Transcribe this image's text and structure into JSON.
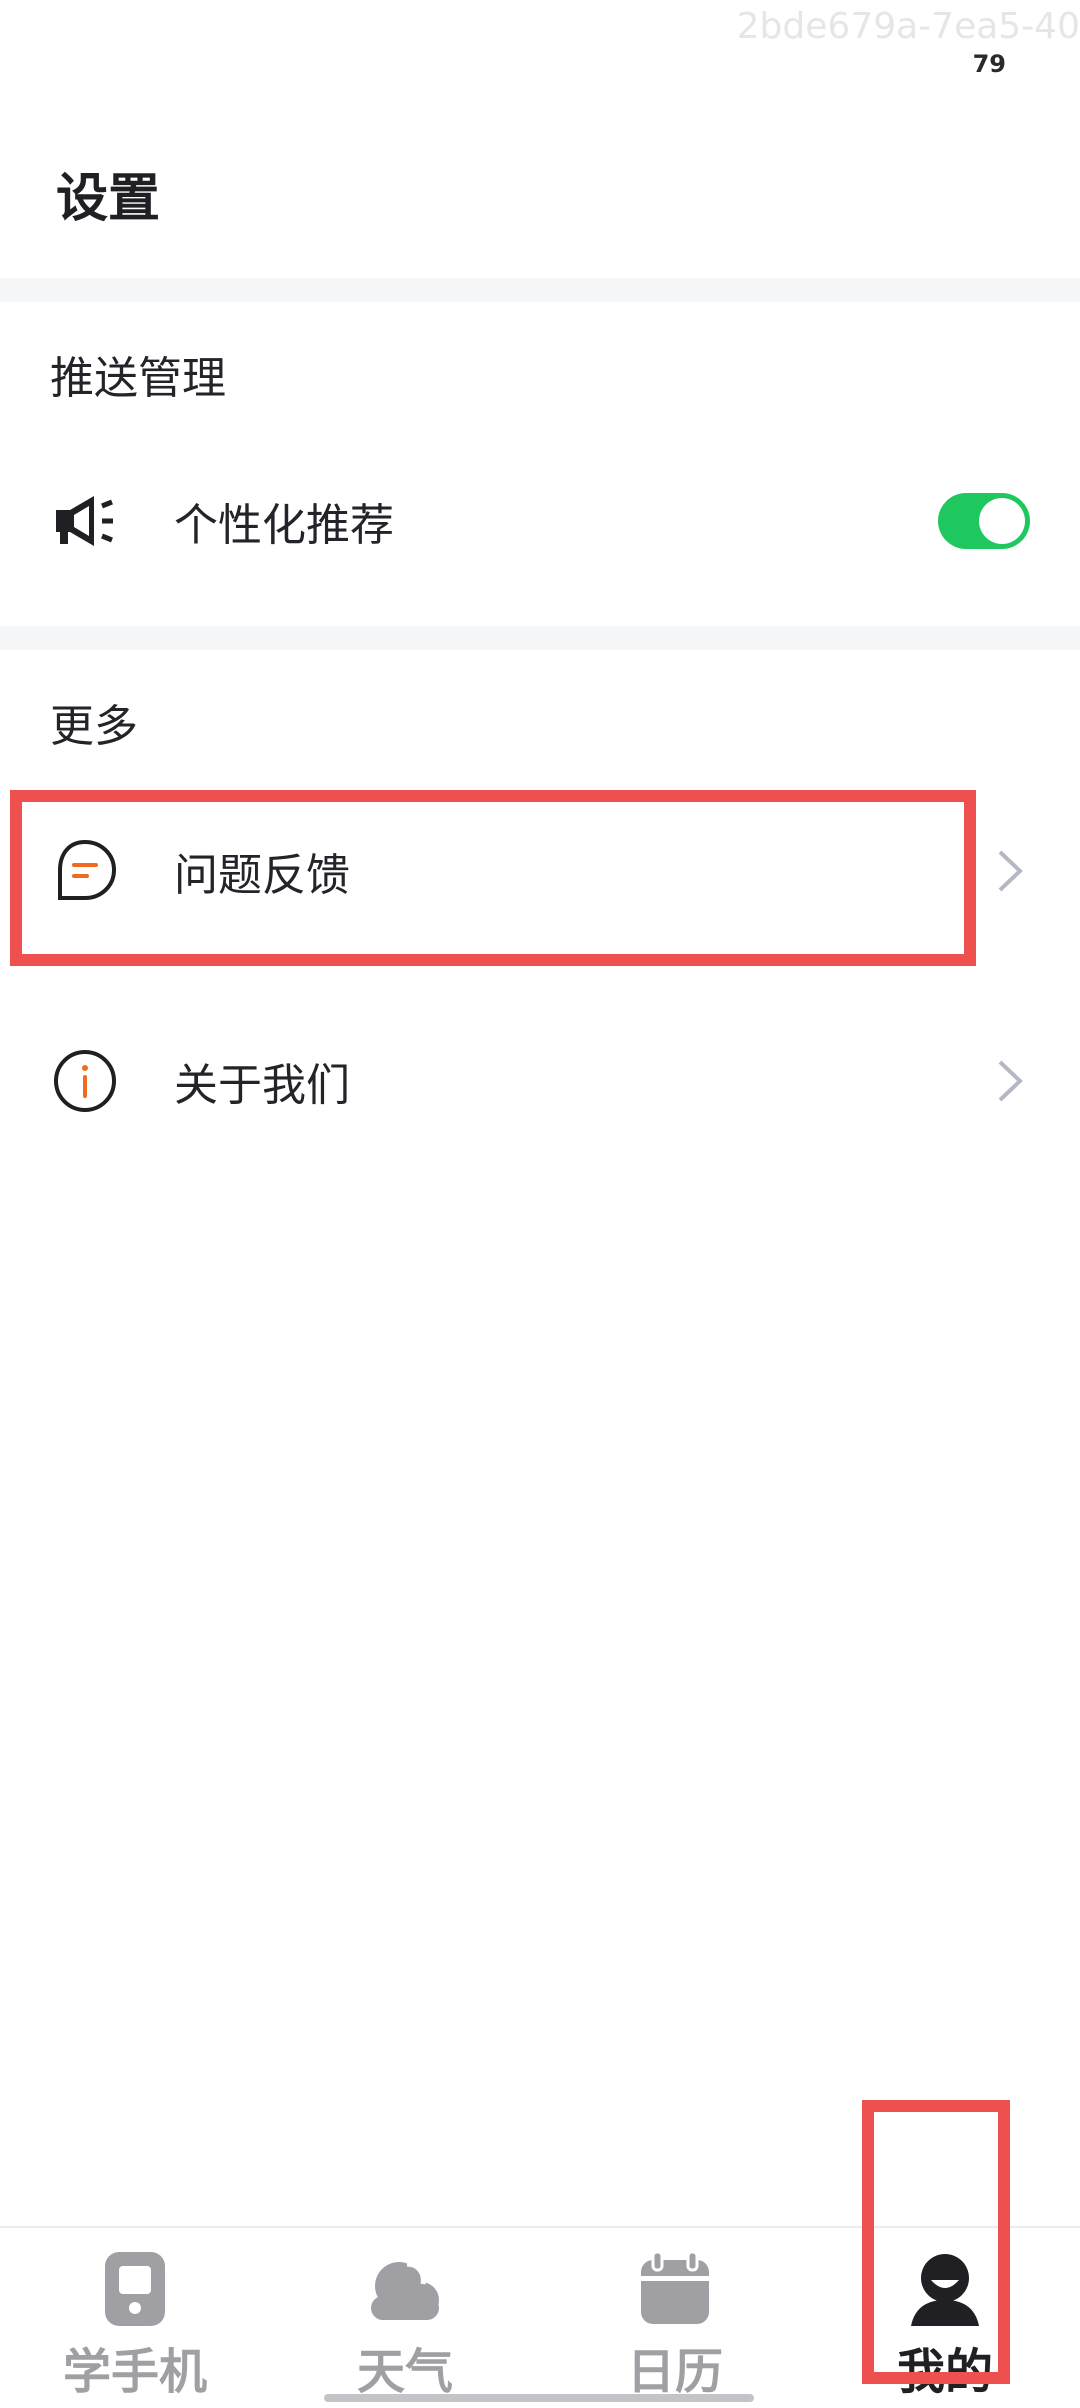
{
  "watermark": "2bde679a-7ea5-40",
  "status_bar": {
    "battery": "79"
  },
  "page": {
    "title": "设置"
  },
  "sections": {
    "push": {
      "label": "推送管理",
      "items": [
        {
          "label": "个性化推荐",
          "icon": "megaphone-icon",
          "toggle_on": true
        }
      ]
    },
    "more": {
      "label": "更多",
      "items": [
        {
          "label": "问题反馈",
          "icon": "feedback-chat-icon"
        },
        {
          "label": "关于我们",
          "icon": "info-icon"
        }
      ]
    }
  },
  "tabbar": {
    "tabs": [
      {
        "label": "学手机",
        "icon": "phone-icon",
        "active": false
      },
      {
        "label": "天气",
        "icon": "weather-cloud-icon",
        "active": false
      },
      {
        "label": "日历",
        "icon": "calendar-icon",
        "active": false
      },
      {
        "label": "我的",
        "icon": "profile-icon",
        "active": true
      }
    ]
  },
  "colors": {
    "toggle_on": "#1ec85f",
    "accent_orange": "#f26a21",
    "highlight": "#ee5050",
    "tab_inactive": "#a0a0a4",
    "tab_active": "#1f1f24"
  }
}
